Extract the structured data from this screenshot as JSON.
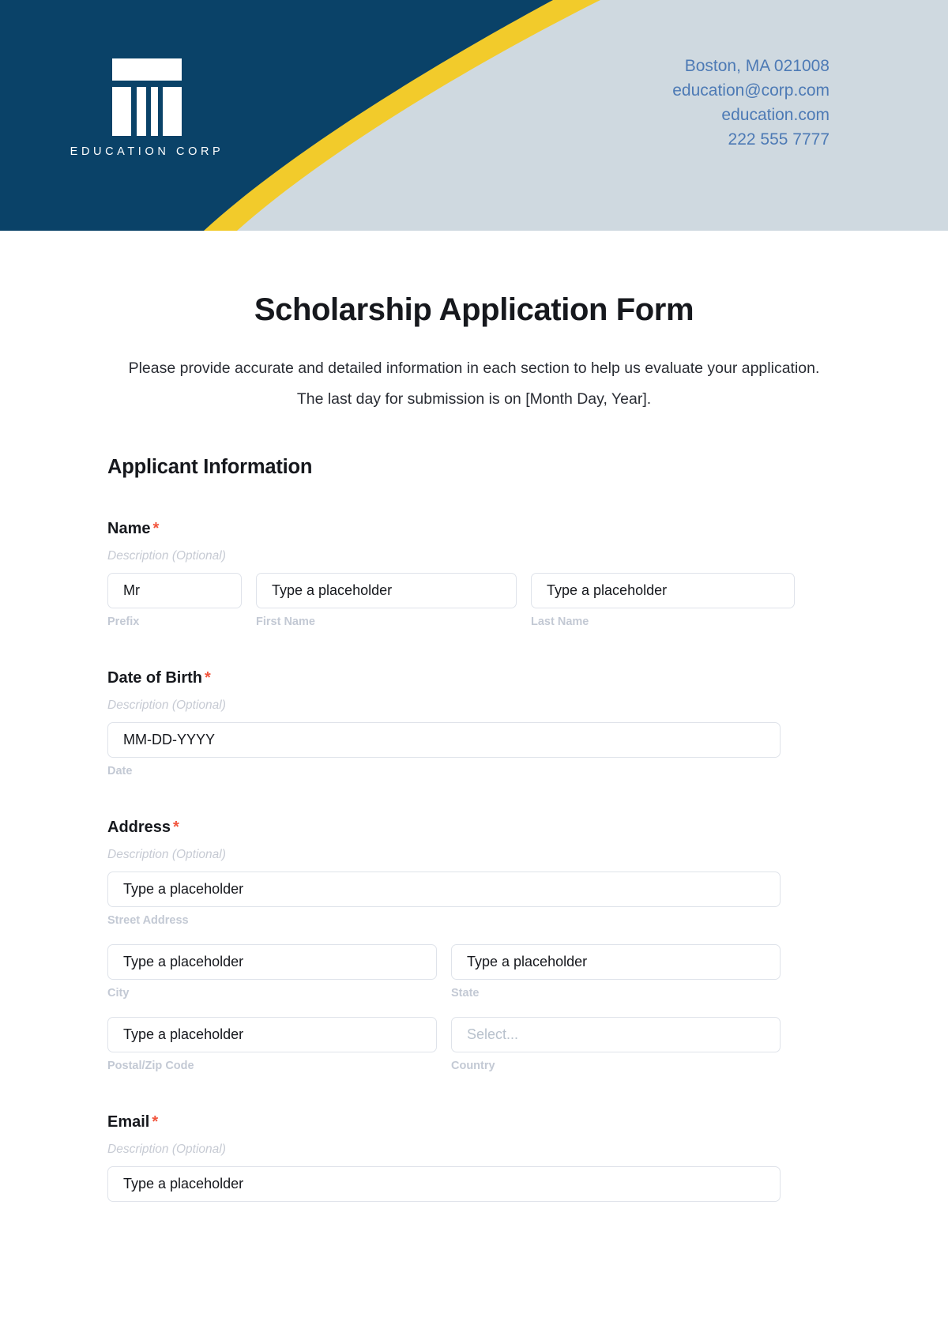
{
  "header": {
    "logo_text": "EDUCATION CORP",
    "logo_icon": "pillar-icon",
    "contact": [
      "Boston, MA 021008",
      "education@corp.com",
      "education.com",
      "222 555 7777"
    ],
    "colors": {
      "navy": "#0a4268",
      "yellow": "#f2cb2b",
      "light_blue_gray": "#cfd9e0",
      "contact_text": "#4d7ab5"
    }
  },
  "form": {
    "title": "Scholarship Application Form",
    "description": "Please provide accurate and detailed information in each section to help us evaluate your application. The last day for submission is on [Month Day, Year].",
    "required_marker": "*",
    "section_heading": "Applicant Information",
    "default_description": "Description (Optional)",
    "placeholder": "Type a placeholder",
    "fields": {
      "name": {
        "label": "Name",
        "description": "Description (Optional)",
        "prefix": {
          "value": "Mr",
          "sub_label": "Prefix"
        },
        "first_name": {
          "value": "Type a placeholder",
          "sub_label": "First Name"
        },
        "last_name": {
          "value": "Type a placeholder",
          "sub_label": "Last Name"
        }
      },
      "date_of_birth": {
        "label": "Date of Birth",
        "description": "Description (Optional)",
        "date": {
          "value": "MM-DD-YYYY",
          "sub_label": "Date"
        }
      },
      "address": {
        "label": "Address",
        "description": "Description (Optional)",
        "street": {
          "value": "Type a placeholder",
          "sub_label": "Street Address"
        },
        "city": {
          "value": "Type a placeholder",
          "sub_label": "City"
        },
        "state": {
          "value": "Type a placeholder",
          "sub_label": "State"
        },
        "postal": {
          "value": "Type a placeholder",
          "sub_label": "Postal/Zip Code"
        },
        "country": {
          "value": "Select...",
          "sub_label": "Country"
        }
      },
      "email": {
        "label": "Email",
        "description": "Description (Optional)",
        "email_input": {
          "value": "Type a placeholder"
        }
      }
    }
  }
}
